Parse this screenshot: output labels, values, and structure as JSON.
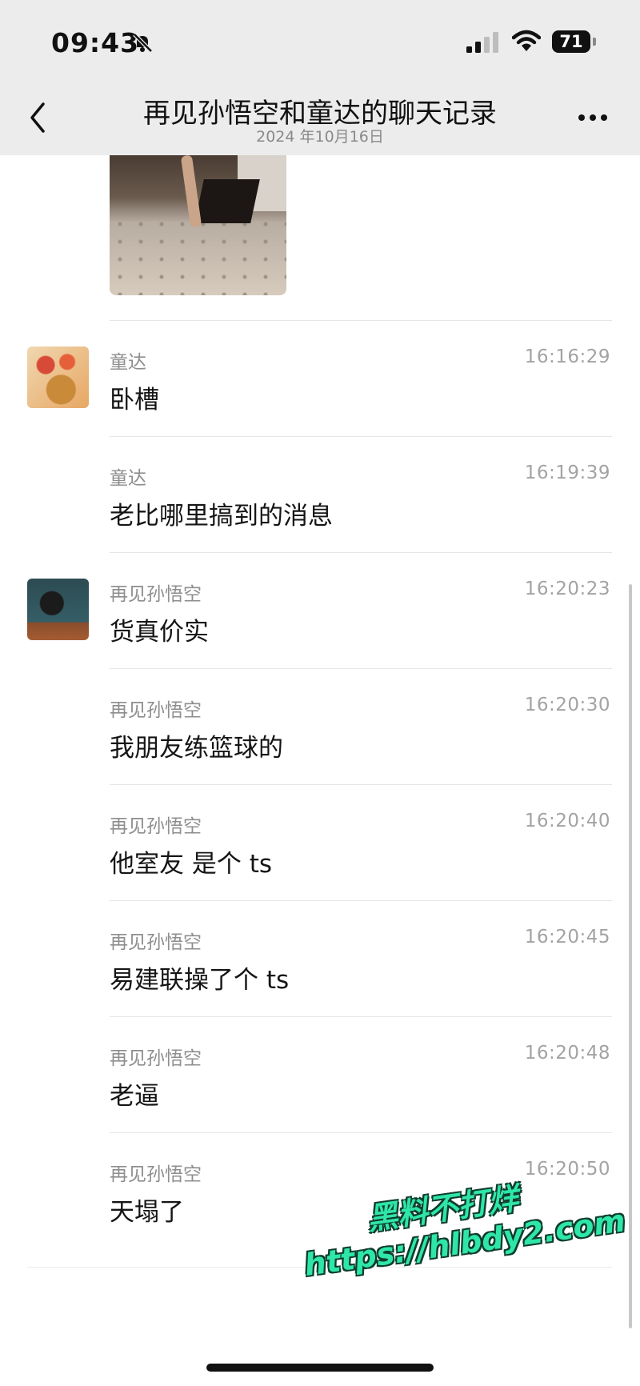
{
  "status": {
    "time": "09:43",
    "battery": "71"
  },
  "header": {
    "title": "再见孙悟空和童达的聊天记录",
    "subtitle": "2024 年10月16日"
  },
  "messages": [
    {
      "sender": "童达",
      "time": "16:16:29",
      "text": "卧槽",
      "avatar": "avatar-tongda"
    },
    {
      "sender": "童达",
      "time": "16:19:39",
      "text": "老比哪里搞到的消息"
    },
    {
      "sender": "再见孙悟空",
      "time": "16:20:23",
      "text": "货真价实",
      "avatar": "avatar-zaijian"
    },
    {
      "sender": "再见孙悟空",
      "time": "16:20:30",
      "text": "我朋友练篮球的"
    },
    {
      "sender": "再见孙悟空",
      "time": "16:20:40",
      "text": "他室友 是个 ts"
    },
    {
      "sender": "再见孙悟空",
      "time": "16:20:45",
      "text": "易建联操了个 ts"
    },
    {
      "sender": "再见孙悟空",
      "time": "16:20:48",
      "text": "老逼"
    },
    {
      "sender": "再见孙悟空",
      "time": "16:20:50",
      "text": "天塌了"
    }
  ],
  "watermark": {
    "line1": "黑料不打烊",
    "line2": "https://hlbdy2.com"
  },
  "icons": [
    "bell-off-icon",
    "signal-icon",
    "wifi-icon",
    "battery-icon",
    "back-chevron-icon",
    "more-icon"
  ]
}
